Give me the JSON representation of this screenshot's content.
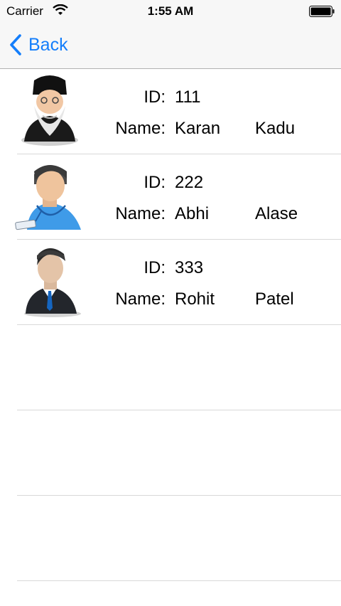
{
  "status": {
    "carrier": "Carrier",
    "time": "1:55 AM"
  },
  "nav": {
    "back_label": "Back",
    "accent": "#147efb"
  },
  "labels": {
    "id": "ID:",
    "name": "Name:"
  },
  "rows": [
    {
      "id": "111",
      "first": "Karan",
      "last": "Kadu",
      "avatar": "elder-turban-avatar"
    },
    {
      "id": "222",
      "first": "Abhi",
      "last": "Alase",
      "avatar": "blue-shirt-badge-avatar"
    },
    {
      "id": "333",
      "first": "Rohit",
      "last": "Patel",
      "avatar": "business-suit-avatar"
    }
  ]
}
